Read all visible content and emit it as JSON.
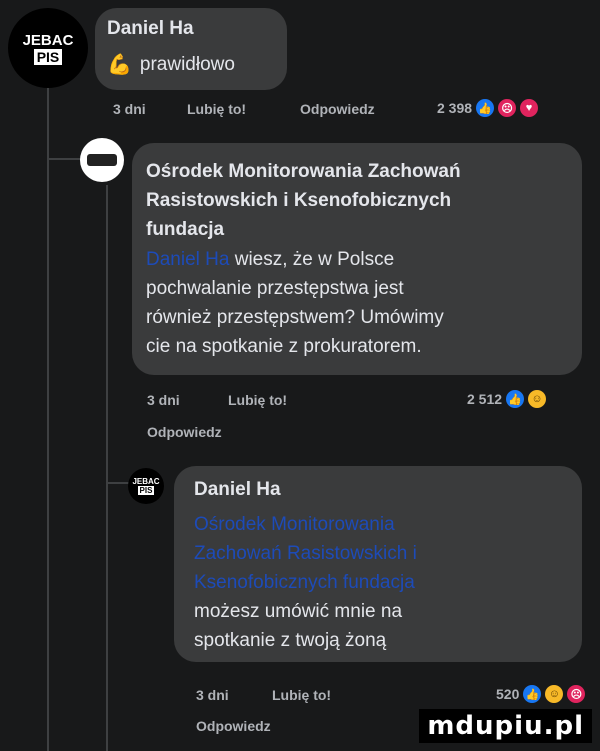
{
  "comment1": {
    "avatar_text": {
      "top": "JEBAC",
      "bottom": "PIS"
    },
    "author": "Daniel Ha",
    "emoji": "💪",
    "text": "prawidłowo",
    "time": "3 dni",
    "like_label": "Lubię to!",
    "reply_label": "Odpowiedz",
    "reaction_count": "2 398",
    "reactions": [
      "like-icon",
      "angry-icon",
      "love-icon"
    ]
  },
  "reply1": {
    "author": "Ośrodek Monitorowania Zachowań Rasistowskich i Ksenofobicznych fundacja",
    "mention": "Daniel Ha",
    "text_lines": [
      "wiesz, że w Polsce",
      "pochwalanie przestępstwa jest",
      "również przestępstwem? Umówimy",
      "cie na spotkanie z prokuratorem."
    ],
    "time": "3 dni",
    "like_label": "Lubię to!",
    "reply_label": "Odpowiedz",
    "reaction_count": "2 512",
    "reactions": [
      "like-icon",
      "haha-icon"
    ]
  },
  "reply2": {
    "avatar_text": {
      "top": "JEBAC",
      "bottom": "PIS"
    },
    "author": "Daniel Ha",
    "mention_lines": [
      "Ośrodek Monitorowania",
      "Zachowań Rasistowskich i",
      "Ksenofobicznych fundacja"
    ],
    "text_lines": [
      "możesz umówić mnie na",
      "spotkanie z twoją żoną"
    ],
    "time": "3 dni",
    "like_label": "Lubię to!",
    "reply_label": "Odpowiedz",
    "reaction_count": "520",
    "reactions": [
      "like-icon",
      "haha-icon",
      "angry-icon"
    ]
  },
  "watermark": "mdupiu.pl",
  "colors": {
    "background": "#18191a",
    "bubble": "#3a3b3c",
    "mention": "#1d4bb8",
    "like": "#1877f2"
  }
}
